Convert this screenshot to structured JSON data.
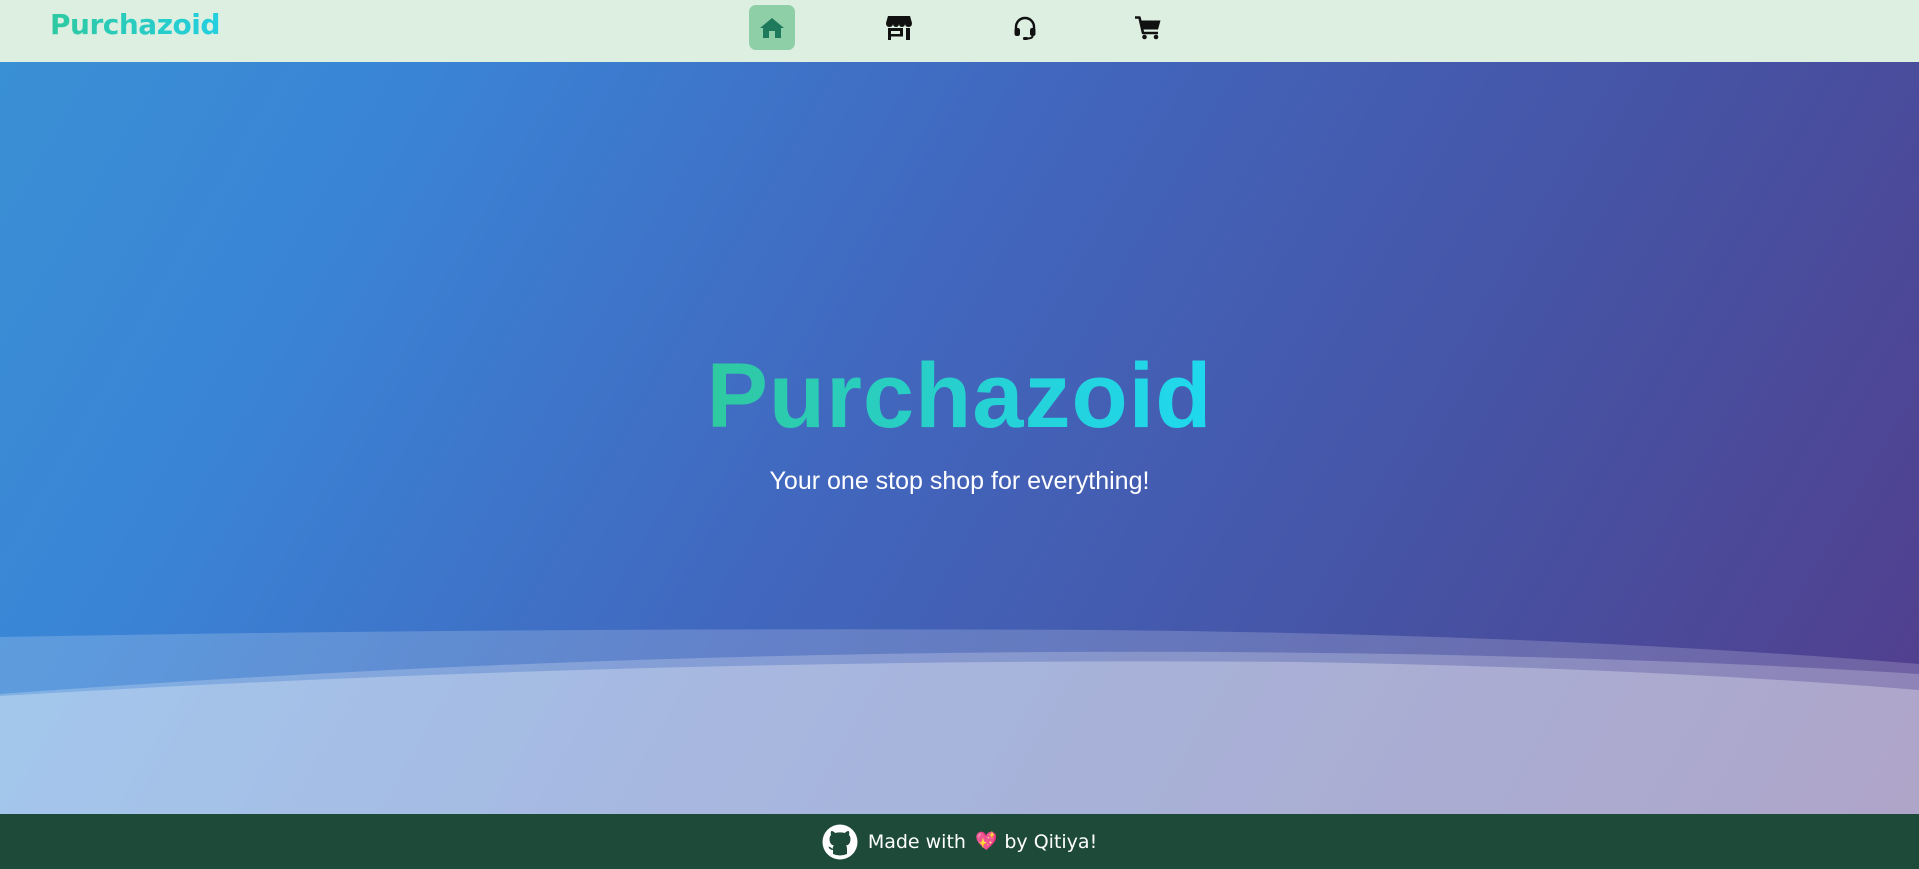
{
  "nav": {
    "brand": "Purchazoid",
    "items": [
      {
        "icon": "home-icon",
        "active": true
      },
      {
        "icon": "store-icon",
        "active": false
      },
      {
        "icon": "headset-icon",
        "active": false
      },
      {
        "icon": "cart-icon",
        "active": false
      }
    ]
  },
  "hero": {
    "title": "Purchazoid",
    "subtitle": "Your one stop shop for everything!"
  },
  "footer": {
    "github_icon": "github-icon",
    "made_with": "Made with",
    "heart": "💖",
    "by": "by Qitiya!"
  },
  "colors": {
    "navbar_bg": "#dcefe0",
    "active_nav_bg": "#8fcfa8",
    "brand_gradient_start": "#2ec9a0",
    "brand_gradient_end": "#23cfe0",
    "hero_gradient_start": "#3a90d4",
    "hero_gradient_end": "#533d8c",
    "footer_bg": "#1e4a3a"
  }
}
